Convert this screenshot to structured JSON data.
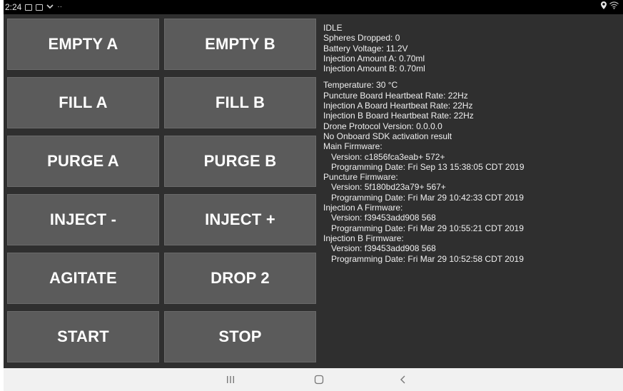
{
  "status_bar": {
    "time": "2:24",
    "notification_icons": [
      "image-icon",
      "gallery-icon",
      "download-icon",
      "more-dots-icon"
    ],
    "right_icons": [
      "location-icon",
      "wifi-icon"
    ]
  },
  "buttons": [
    {
      "label": "EMPTY A"
    },
    {
      "label": "EMPTY B"
    },
    {
      "label": "FILL A"
    },
    {
      "label": "FILL B"
    },
    {
      "label": "PURGE A"
    },
    {
      "label": "PURGE B"
    },
    {
      "label": "INJECT -"
    },
    {
      "label": "INJECT +"
    },
    {
      "label": "AGITATE"
    },
    {
      "label": "DROP 2"
    },
    {
      "label": "START"
    },
    {
      "label": "STOP"
    }
  ],
  "status_block": {
    "state": "IDLE",
    "spheres_dropped": "Spheres Dropped: 0",
    "battery_voltage": "Battery Voltage: 11.2V",
    "injection_amount_a": "Injection Amount A: 0.70ml",
    "injection_amount_b": "Injection Amount B: 0.70ml"
  },
  "diagnostics": {
    "temperature": "Temperature: 30 °C",
    "puncture_heartbeat": "Puncture Board Heartbeat Rate: 22Hz",
    "injection_a_heartbeat": "Injection A Board Heartbeat Rate: 22Hz",
    "injection_b_heartbeat": "Injection B Board Heartbeat Rate: 22Hz",
    "drone_protocol": "Drone Protocol Version: 0.0.0.0",
    "sdk_activation": "No Onboard SDK activation result",
    "main_fw_title": "Main Firmware:",
    "main_fw_version": "Version: c1856fca3eab+ 572+",
    "main_fw_date": "Programming Date: Fri Sep 13 15:38:05 CDT 2019",
    "puncture_fw_title": "Puncture Firmware:",
    "puncture_fw_version": "Version: 5f180bd23a79+ 567+",
    "puncture_fw_date": "Programming Date: Fri Mar 29 10:42:33 CDT 2019",
    "inj_a_fw_title": "Injection A Firmware:",
    "inj_a_fw_version": "Version: f39453add908 568",
    "inj_a_fw_date": "Programming Date: Fri Mar 29 10:55:21 CDT 2019",
    "inj_b_fw_title": "Injection B Firmware:",
    "inj_b_fw_version": "Version: f39453add908 568",
    "inj_b_fw_date": "Programming Date: Fri Mar 29 10:52:58 CDT 2019"
  },
  "nav_bar": {
    "buttons": [
      "recent-apps-icon",
      "home-icon",
      "back-icon"
    ]
  },
  "colors": {
    "app_background": "#2f2f2f",
    "button_background": "#5b5b5b",
    "status_bar": "#000000",
    "nav_bar": "#f1f1f1",
    "text": "#ffffff"
  }
}
